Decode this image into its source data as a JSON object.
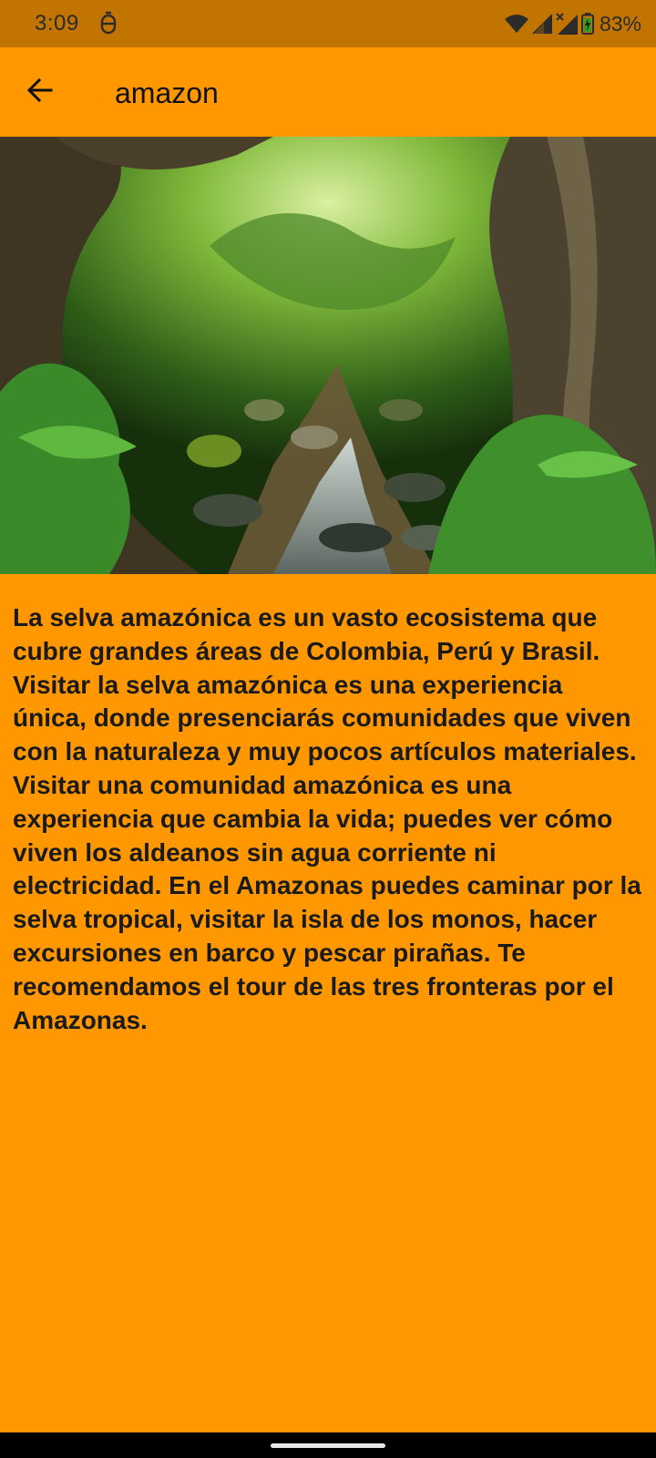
{
  "status_bar": {
    "time": "3:09",
    "battery_percent": "83%",
    "icons": [
      "notification-icon",
      "wifi-icon",
      "cell-signal-icon",
      "cell-signal-no-data-icon",
      "battery-charging-icon"
    ]
  },
  "app_bar": {
    "back_icon": "arrow-back-icon",
    "title": "amazon"
  },
  "content": {
    "image": "amazon-rainforest-photo",
    "description": "La selva amazónica es un vasto ecosistema que cubre grandes áreas de Colombia, Perú y Brasil. Visitar la selva amazónica es una experiencia única, donde presenciarás comunidades que viven con la naturaleza y muy pocos artículos materiales. Visitar una comunidad amazónica es una experiencia que cambia la vida; puedes ver cómo viven los aldeanos sin agua corriente ni electricidad. En el Amazonas puedes caminar por la selva tropical, visitar la isla de los monos, hacer excursiones en barco y pescar pirañas. Te recomendamos el tour de las tres fronteras por el Amazonas."
  },
  "colors": {
    "status_bar": "#C17400",
    "primary": "#FF9800",
    "text": "#1a1a1a",
    "nav_bar": "#000000"
  }
}
